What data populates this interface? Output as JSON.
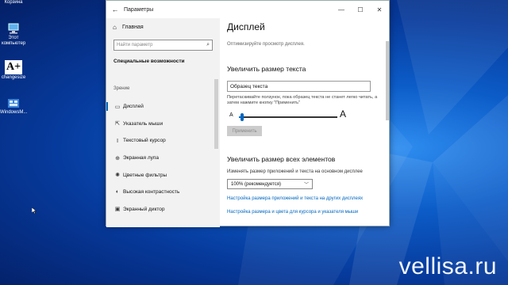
{
  "desktop": {
    "icons": [
      {
        "label": "Корзина",
        "icon": "recycle-bin-icon"
      },
      {
        "label": "Этот компьютер",
        "icon": "computer-icon"
      },
      {
        "label": "changesize",
        "icon": "font-size-icon",
        "glyph": "A+"
      },
      {
        "label": "WindowsM...",
        "icon": "app-icon"
      }
    ],
    "watermark": "vellisa.ru"
  },
  "window": {
    "title": "Параметры",
    "controls": {
      "minimize": "—",
      "maximize": "☐",
      "close": "✕"
    }
  },
  "sidebar": {
    "home": "Главная",
    "search_placeholder": "Найти параметр",
    "section_title": "Специальные возможности",
    "group_label": "Зрение",
    "items": [
      {
        "label": "Дисплей",
        "icon": "display-icon",
        "active": true
      },
      {
        "label": "Указатель мыши",
        "icon": "mouse-pointer-icon"
      },
      {
        "label": "Текстовый курсор",
        "icon": "text-cursor-icon"
      },
      {
        "label": "Экранная лупа",
        "icon": "magnifier-icon"
      },
      {
        "label": "Цветные фильтры",
        "icon": "color-filters-icon"
      },
      {
        "label": "Высокая контрастность",
        "icon": "contrast-icon"
      },
      {
        "label": "Экранный диктор",
        "icon": "narrator-icon"
      }
    ]
  },
  "main": {
    "title": "Дисплей",
    "subtitle": "Оптимизируйте просмотр дисплея.",
    "text_size": {
      "heading": "Увеличить размер текста",
      "sample": "Образец текста",
      "description": "Перетаскивайте ползунок, пока образец текста не станет легко читать, а затем нажмите кнопку \"Применить\"",
      "slider_min_label": "A",
      "slider_max_label": "A",
      "slider_value": 0.03,
      "apply_label": "Применить"
    },
    "scale": {
      "heading": "Увеличить размер всех элементов",
      "label": "Изменять размер приложений и текста на основном дисплее",
      "selected": "100% (рекомендуется)",
      "links": [
        "Настройка размера приложений и текста на других дисплеях",
        "Настройка размера и цвета для курсора и указателя мыши"
      ]
    }
  },
  "colors": {
    "accent": "#0067c0",
    "sidebar_bg": "#f2f2f2",
    "desktop": "#0c5cc8"
  }
}
